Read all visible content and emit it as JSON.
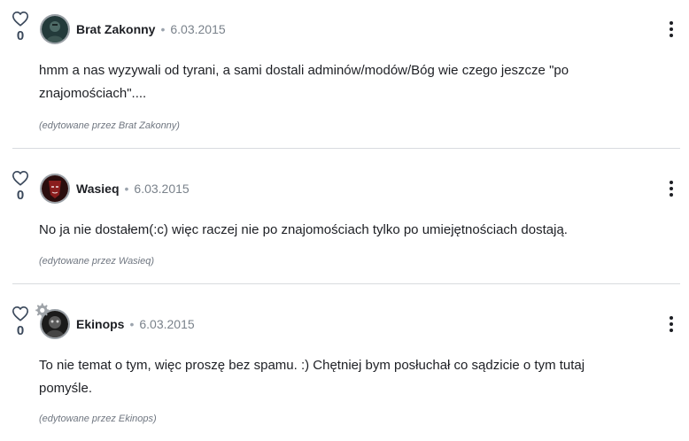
{
  "comments": [
    {
      "likes": "0",
      "author": "Brat Zakonny",
      "separator": "•",
      "date": "6.03.2015",
      "text": "hmm a nas wyzywali od tyrani, a sami dostali adminów/modów/Bóg wie czego jeszcze \"po znajomościach\"....",
      "edited": "(edytowane przez Brat Zakonny)"
    },
    {
      "likes": "0",
      "author": "Wasieq",
      "separator": "•",
      "date": "6.03.2015",
      "text": "No ja nie dostałem(:c) więc raczej nie po znajomościach tylko po umiejętnościach dostają.",
      "edited": "(edytowane przez Wasieq)"
    },
    {
      "likes": "0",
      "author": "Ekinops",
      "separator": "•",
      "date": "6.03.2015",
      "text": "To nie temat o tym, więc proszę bez spamu. :) Chętniej bym posłuchał co sądzicie o tym tutaj pomyśle.",
      "edited": "(edytowane przez Ekinops)"
    }
  ],
  "icons": {
    "like": "heart-icon",
    "menu": "more-vertical-icon",
    "badge": "gear-icon"
  }
}
